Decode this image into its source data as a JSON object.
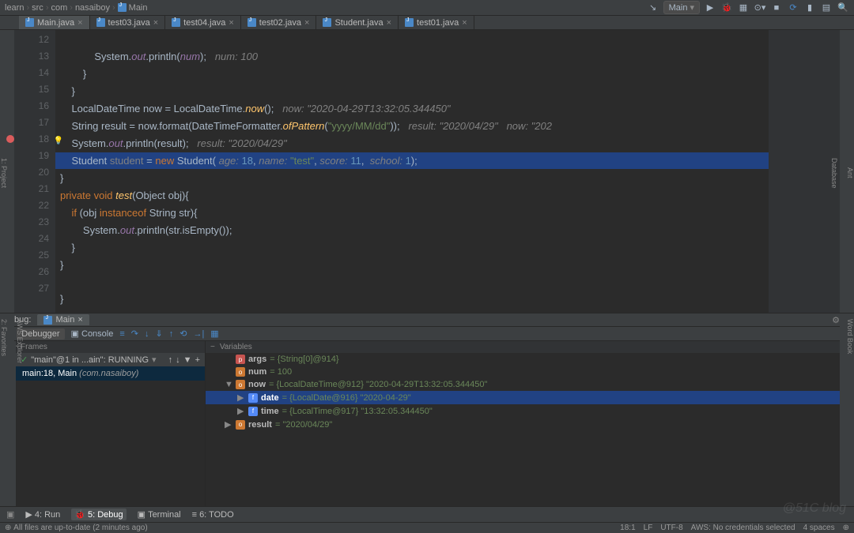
{
  "breadcrumb": [
    "learn",
    "src",
    "com",
    "nasaiboy",
    "Main"
  ],
  "run_config": "Main",
  "tabs": [
    {
      "label": "Main.java",
      "active": true
    },
    {
      "label": "test03.java",
      "active": false
    },
    {
      "label": "test04.java",
      "active": false
    },
    {
      "label": "test02.java",
      "active": false
    },
    {
      "label": "Student.java",
      "active": false
    },
    {
      "label": "test01.java",
      "active": false
    }
  ],
  "side_left": [
    "1: Project",
    "7: Structure"
  ],
  "side_right": [
    "Ant",
    "Database"
  ],
  "side_left_bottom": [
    "2: Favorites",
    "AWS Explorer"
  ],
  "side_right_bottom": [
    "Word Book"
  ],
  "lines": {
    "start": 12,
    "end": 27,
    "bp_line": 18,
    "12": {
      "pre": "            System.",
      "fld": "out",
      ".println(": ".println(",
      "arg": "num",
      "post": ");   ",
      "cmt": "num: 100"
    },
    "13": "        }",
    "14": "    }",
    "15": {
      "pre": "    LocalDateTime now = LocalDateTime.",
      "fn": "now",
      "post": "();   ",
      "cmt": "now: \"2020-04-29T13:32:05.344450\""
    },
    "16": {
      "pre": "    String result = now.format(DateTimeFormatter.",
      "fn": "ofPattern",
      "args": "(",
      "str": "\"yyyy/MM/dd\"",
      "post": "));   ",
      "cmt": "result: \"2020/04/29\"   now: \"202"
    },
    "17": {
      "pre": "    System.",
      "fld": "out",
      "mid": ".println(result);   ",
      "cmt": "result: \"2020/04/29\""
    },
    "18": {
      "pre": "    Student ",
      "var": "student",
      "mid": " = ",
      "kw": "new",
      "typ": " Student(",
      "p1": " age: ",
      "n1": "18",
      "c1": ",",
      "p2": " name: ",
      "s1": "\"test\"",
      "c2": ",",
      "p3": " score: ",
      "n2": "11",
      "c3": ",",
      "p4": "  school: ",
      "n3": "1",
      "end": ");"
    },
    "19": "}",
    "20": {
      "kw1": "private",
      "sp1": " ",
      "kw2": "void",
      "sp2": " ",
      "fn": "test",
      "args": "(Object obj){"
    },
    "21": {
      "pre": "    ",
      "kw1": "if",
      "mid": " (obj ",
      "kw2": "instanceof",
      "post": " String str){"
    },
    "22": {
      "pre": "        System.",
      "fld": "out",
      "mid": ".println(str.isEmpty());"
    },
    "23": "    }",
    "24": "}",
    "26": "}"
  },
  "debug": {
    "title": "Debug:",
    "tab": "Main",
    "subtabs": {
      "debugger": "Debugger",
      "console": "Console"
    },
    "frames_title": "Frames",
    "vars_title": "Variables",
    "thread": "\"main\"@1 in ...ain\": RUNNING",
    "frame": {
      "loc": "main:18, Main ",
      "pkg": "(com.nasaiboy)"
    },
    "vars": [
      {
        "icon": "p",
        "name": "args",
        "val": " = {String[0]@914}"
      },
      {
        "icon": "o",
        "name": "num",
        "val": " = 100"
      },
      {
        "arrow": "▼",
        "icon": "o",
        "name": "now",
        "val": " = {LocalDateTime@912} \"2020-04-29T13:32:05.344450\""
      },
      {
        "arrow": "▶",
        "indent": 1,
        "sel": true,
        "icon": "f",
        "name": "date",
        "val": " = {LocalDate@916} \"2020-04-29\""
      },
      {
        "arrow": "▶",
        "indent": 1,
        "icon": "f",
        "name": "time",
        "val": " = {LocalTime@917} \"13:32:05.344450\""
      },
      {
        "arrow": "▶",
        "icon": "o",
        "name": "result",
        "val": " = \"2020/04/29\""
      }
    ]
  },
  "bottom_tabs": [
    {
      "icon": "▶",
      "label": "4: Run"
    },
    {
      "icon": "🐞",
      "label": "5: Debug",
      "active": true
    },
    {
      "icon": "▣",
      "label": "Terminal"
    },
    {
      "icon": "≡",
      "label": "6: TODO"
    }
  ],
  "status": {
    "left": "All files are up-to-date (2 minutes ago)",
    "right": [
      "18:1",
      "LF",
      "UTF-8",
      "AWS: No credentials selected",
      "4 spaces",
      "⊕"
    ]
  },
  "watermark": "@51C blog"
}
